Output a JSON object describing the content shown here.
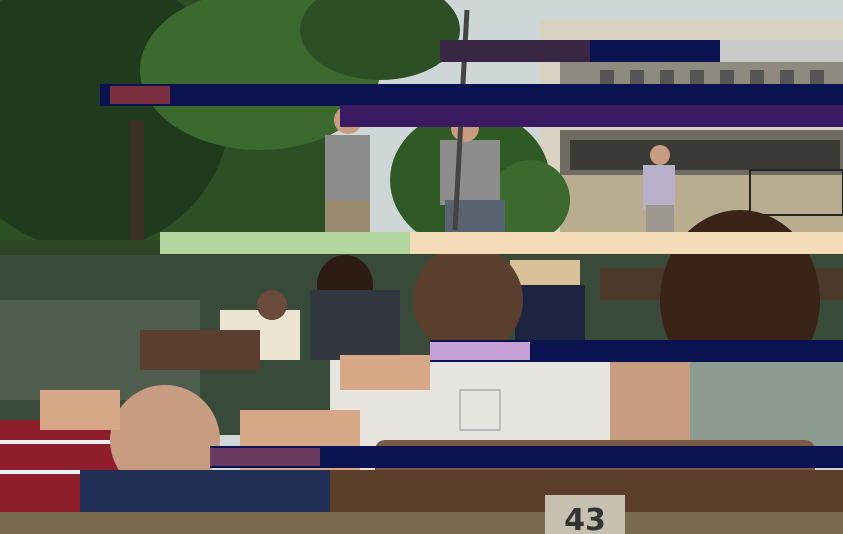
{
  "photo": {
    "boat_number": "43"
  },
  "palette": {
    "sky": "#cfd6d8",
    "foliage_dark": "#1f3a1c",
    "foliage_mid": "#3c6a2e",
    "water": "#3a4a3a",
    "stone": "#b9ad8f",
    "glitch_navy": "#0b1250",
    "glitch_peach": "#f5dcb8",
    "boat_wood": "#5b3d2a"
  }
}
